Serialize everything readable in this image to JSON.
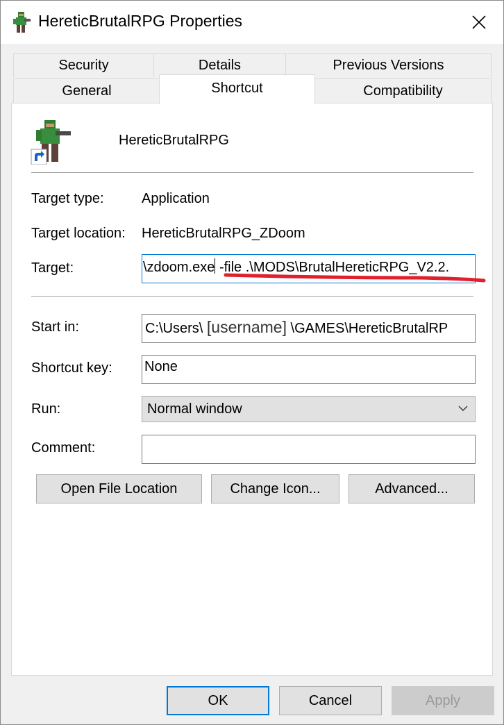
{
  "window": {
    "title": "HereticBrutalRPG Properties",
    "close_glyph": "✕"
  },
  "tabs": {
    "row1": [
      "Security",
      "Details",
      "Previous Versions"
    ],
    "row2": [
      "General",
      "Shortcut",
      "Compatibility"
    ],
    "active": "Shortcut"
  },
  "shortcut": {
    "name": "HereticBrutalRPG",
    "target_type_label": "Target type:",
    "target_type_value": "Application",
    "target_location_label": "Target location:",
    "target_location_value": "HereticBrutalRPG_ZDoom",
    "target_label": "Target:",
    "target_value_part1": "\\zdoom.exe",
    "target_value_part2": " -file .\\MODS\\BrutalHereticRPG_V2.2.",
    "start_in_label": "Start in:",
    "start_in_part1": "C:\\Users\\",
    "start_in_username": "[username]",
    "start_in_part2": "\\GAMES\\HereticBrutalRP",
    "shortcut_key_label": "Shortcut key:",
    "shortcut_key_value": "None",
    "run_label": "Run:",
    "run_value": "Normal window",
    "comment_label": "Comment:",
    "comment_value": ""
  },
  "buttons": {
    "open_file_location": "Open File Location",
    "change_icon": "Change Icon...",
    "advanced": "Advanced...",
    "ok": "OK",
    "cancel": "Cancel",
    "apply": "Apply"
  },
  "colors": {
    "annotation_underline": "#e0202c",
    "focus_border": "#0078d7"
  }
}
